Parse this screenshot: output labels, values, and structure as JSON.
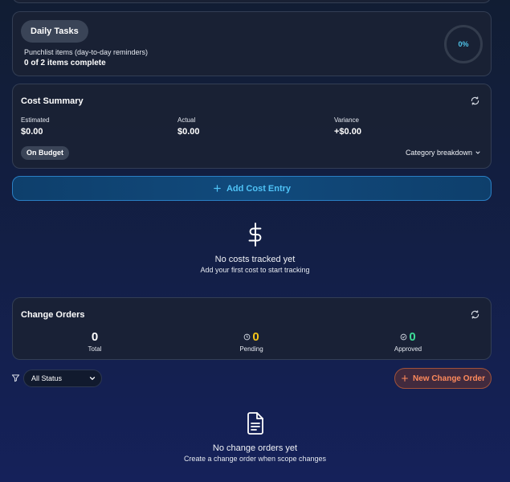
{
  "daily_tasks": {
    "title": "Daily Tasks",
    "subtitle": "Punchlist items (day-to-day reminders)",
    "count": "0 of 2 items complete",
    "progress_label": "0%",
    "progress_fraction": 0
  },
  "cost_summary": {
    "title": "Cost Summary",
    "stats": [
      {
        "label": "Estimated",
        "value": "$0.00"
      },
      {
        "label": "Actual",
        "value": "$0.00"
      },
      {
        "label": "Variance",
        "value": "+$0.00"
      }
    ],
    "badge": "On Budget",
    "breakdown_label": "Category breakdown"
  },
  "add_cost": {
    "label": "Add Cost Entry"
  },
  "costs_empty": {
    "icon": "dollar-icon",
    "title": "No costs tracked yet",
    "subtitle": "Add your first cost to start tracking"
  },
  "change_orders": {
    "title": "Change Orders",
    "stats": [
      {
        "value": "0",
        "label": "Total",
        "color": "#ffffff"
      },
      {
        "value": "0",
        "label": "Pending",
        "color": "#f5c518"
      },
      {
        "value": "0",
        "label": "Approved",
        "color": "#3ddc97"
      }
    ]
  },
  "filter": {
    "selected": "All Status"
  },
  "new_change_order": {
    "label": "New Change Order"
  },
  "co_empty": {
    "icon": "document-icon",
    "title": "No change orders yet",
    "subtitle": "Create a change order when scope changes"
  },
  "colors": {
    "accent_blue": "#4fc3f7",
    "accent_orange": "#ff8a5c",
    "pending": "#f5c518",
    "approved": "#3ddc97"
  }
}
